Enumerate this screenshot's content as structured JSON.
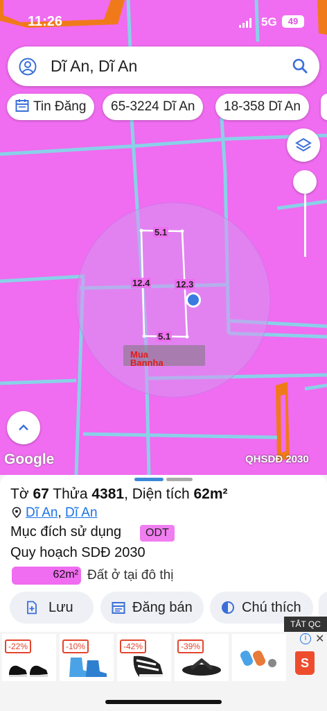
{
  "status_bar": {
    "time": "11:26",
    "network": "5G",
    "battery": "49"
  },
  "search": {
    "text": "Dĩ An, Dĩ An"
  },
  "chips": [
    {
      "label": "Tin Đăng"
    },
    {
      "label": "65-3224 Dĩ An"
    },
    {
      "label": "18-358 Dĩ An"
    }
  ],
  "map": {
    "lot_edges": {
      "top": "5.1",
      "left": "12.4",
      "right": "12.3",
      "bottom": "5.1"
    },
    "watermark": {
      "line1": "Mua",
      "line2": "Bannha"
    },
    "google_logo": "Google",
    "layer_label": "QHSDĐ 2030",
    "land_color": "#f06cf0",
    "road_color": "#8ad0e8"
  },
  "parcel": {
    "title_prefix": "Tờ",
    "sheet_number": "67",
    "plot_prefix": "Thửa",
    "plot_number": "4381",
    "area_prefix": ", Diện tích",
    "area": "62m²",
    "district": "Dĩ An",
    "city": "Dĩ An",
    "purpose_label": "Mục đích sử dụng",
    "purpose_code": "ODT",
    "plan_label": "Quy hoạch SDĐ 2030",
    "plan_area": "62m²",
    "plan_fraction": 1.0,
    "plan_description": "Đất ở tại đô thị"
  },
  "actions": [
    {
      "label": "Lưu",
      "icon": "bookmark-add-icon"
    },
    {
      "label": "Đăng bán",
      "icon": "calendar-icon"
    },
    {
      "label": "Chú thích",
      "icon": "contrast-icon"
    }
  ],
  "ads": {
    "tag": "TẮT QC",
    "items": [
      {
        "discount": "-22%"
      },
      {
        "discount": "-10%"
      },
      {
        "discount": "-42%"
      },
      {
        "discount": "-39%"
      },
      {
        "discount": ""
      }
    ]
  }
}
